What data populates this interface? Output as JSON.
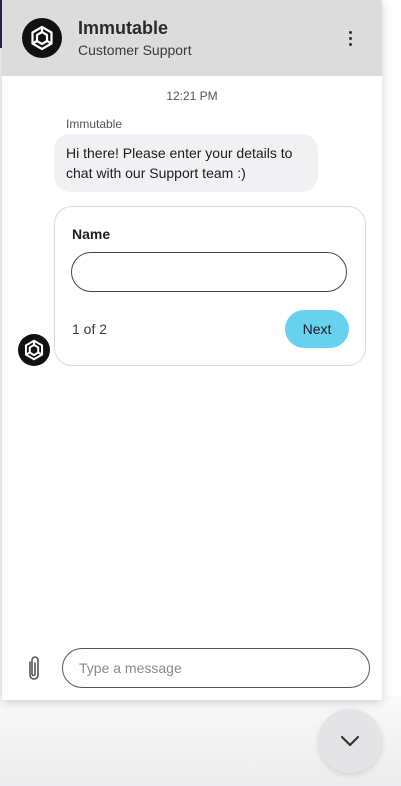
{
  "header": {
    "title": "Immutable",
    "subtitle": "Customer Support",
    "menu_icon": "kebab-menu-icon",
    "avatar_icon": "immutable-logo-icon"
  },
  "conversation": {
    "timestamp": "12:21 PM",
    "sender_name": "Immutable",
    "message": "Hi there! Please enter your details to chat with our Support team :)"
  },
  "form": {
    "field_label": "Name",
    "field_value": "",
    "step_text": "1 of 2",
    "next_label": "Next"
  },
  "composer": {
    "placeholder": "Type a message",
    "attach_icon": "paperclip-icon"
  },
  "launcher": {
    "icon": "chevron-down-icon"
  },
  "colors": {
    "header_bg": "#dcdcdc",
    "accent": "#67d1ee",
    "bubble_bg": "#f1f1f3"
  }
}
